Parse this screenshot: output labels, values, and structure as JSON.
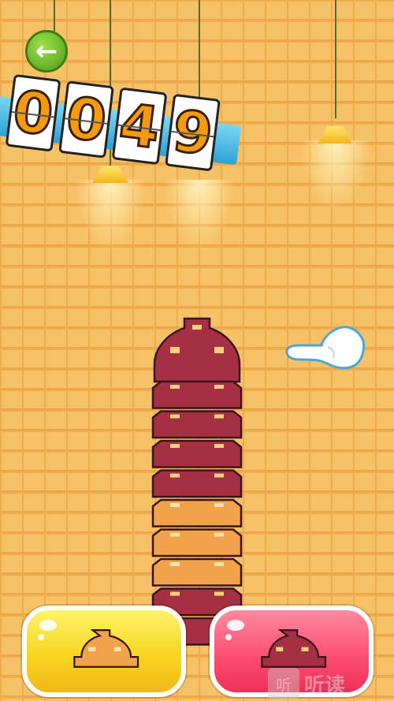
{
  "score": {
    "digits": [
      "0",
      "0",
      "4",
      "9"
    ]
  },
  "controls": {
    "back": "back-arrow-icon",
    "left_button_piece": "orange-block",
    "right_button_piece": "maroon-block"
  },
  "tower": {
    "blocks_from_top": [
      "maroon",
      "maroon",
      "maroon",
      "maroon",
      "orange",
      "orange",
      "orange",
      "maroon",
      "maroon"
    ]
  },
  "colors": {
    "maroon": "#a52f43",
    "orange": "#f2a24a",
    "yellow_button": "#f7d620",
    "pink_button": "#ff4f73"
  },
  "watermark": {
    "badge": "听",
    "text": "听读"
  }
}
